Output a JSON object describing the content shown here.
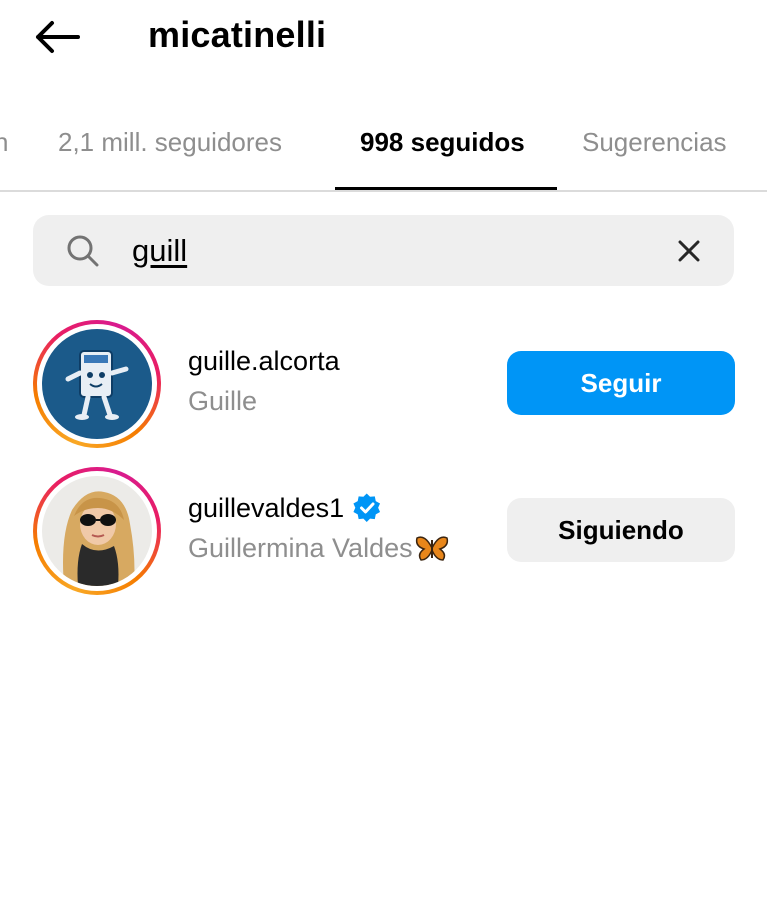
{
  "header": {
    "title": "micatinelli",
    "back_icon": "arrow-left-icon"
  },
  "tabs": [
    {
      "label": "n",
      "active": false
    },
    {
      "label": "2,1 mill. seguidores",
      "active": false
    },
    {
      "label": "998 seguidos",
      "active": true
    },
    {
      "label": "Sugerencias",
      "active": false
    }
  ],
  "search": {
    "value": "guill",
    "placeholder": "Buscar",
    "search_icon": "search-icon",
    "clear_icon": "close-icon"
  },
  "results": [
    {
      "username": "guille.alcorta",
      "full_name": "Guille",
      "verified": false,
      "action_label": "Seguir",
      "action_color": "#0095f6"
    },
    {
      "username": "guillevaldes1",
      "full_name": "Guillermina Valdes",
      "verified": true,
      "emoji": "butterfly-icon",
      "action_label": "Siguiendo",
      "action_color": "#efefef"
    }
  ],
  "colors": {
    "primary_blue": "#0095f6",
    "secondary_gray": "#efefef",
    "muted_text": "#8e8e8e",
    "verified_blue": "#0095f6"
  }
}
